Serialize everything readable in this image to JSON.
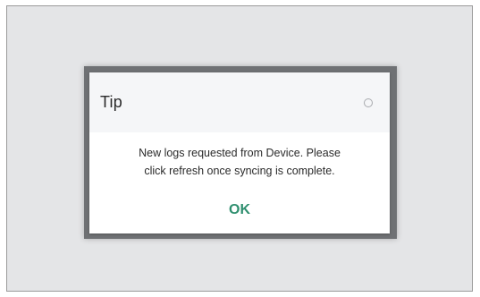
{
  "dialog": {
    "title": "Tip",
    "message_line1": "New logs requested from Device. Please",
    "message_line2": "click refresh once syncing is complete.",
    "ok_label": "OK",
    "close_icon": "close-icon"
  },
  "colors": {
    "background": "#e4e5e7",
    "dialog_header": "#f5f6f8",
    "ok_button_text": "#2f8f6f",
    "close_icon": "#a7a9ad"
  }
}
